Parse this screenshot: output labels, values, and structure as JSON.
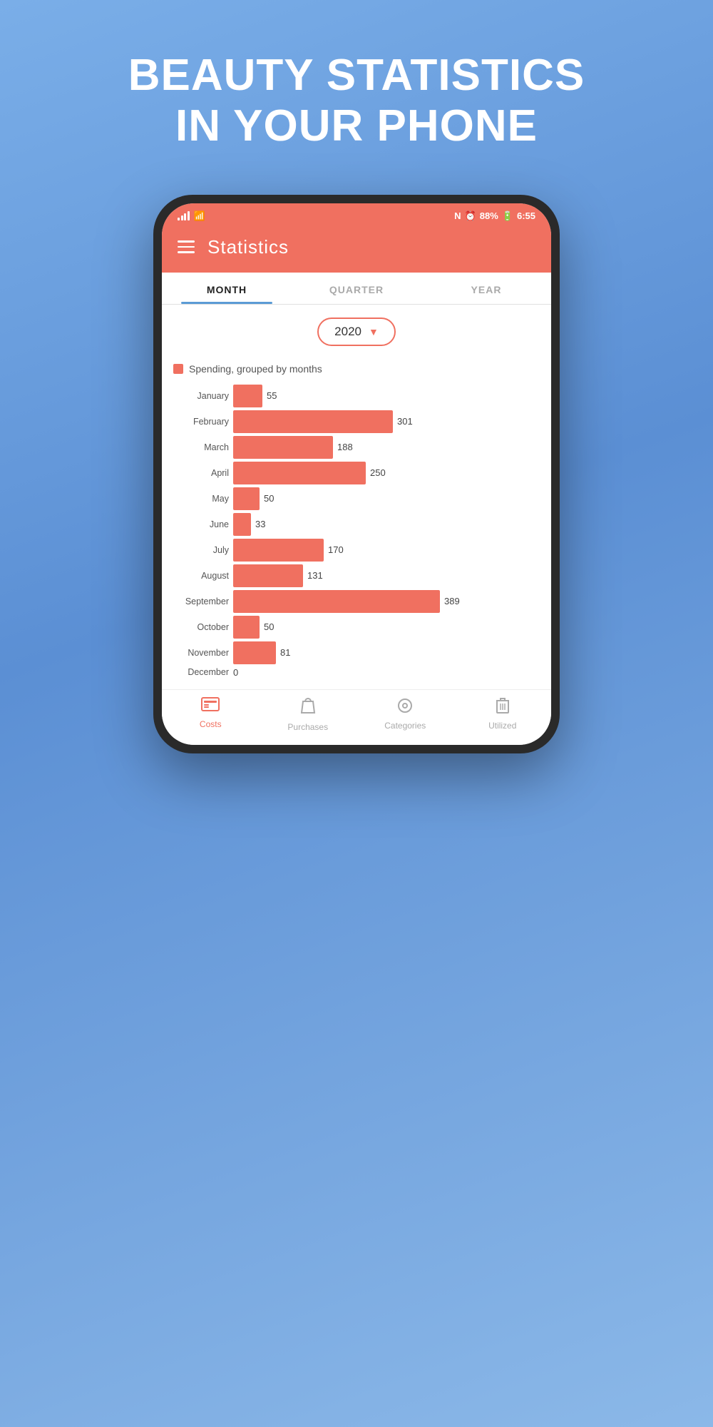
{
  "hero": {
    "line1": "BEAUTY STATISTICS",
    "line2": "IN YOUR PHONE"
  },
  "statusBar": {
    "battery": "88%",
    "time": "6:55"
  },
  "header": {
    "title": "Statistics"
  },
  "tabs": [
    {
      "label": "MONTH",
      "active": true
    },
    {
      "label": "QUARTER",
      "active": false
    },
    {
      "label": "YEAR",
      "active": false
    }
  ],
  "yearSelector": {
    "year": "2020"
  },
  "chart": {
    "legend": "Spending, grouped by months",
    "maxValue": 389,
    "bars": [
      {
        "month": "January",
        "value": 55
      },
      {
        "month": "February",
        "value": 301
      },
      {
        "month": "March",
        "value": 188
      },
      {
        "month": "April",
        "value": 250
      },
      {
        "month": "May",
        "value": 50
      },
      {
        "month": "June",
        "value": 33
      },
      {
        "month": "July",
        "value": 170
      },
      {
        "month": "August",
        "value": 131
      },
      {
        "month": "September",
        "value": 389
      },
      {
        "month": "October",
        "value": 50
      },
      {
        "month": "November",
        "value": 81
      },
      {
        "month": "December",
        "value": 0
      }
    ]
  },
  "bottomNav": [
    {
      "label": "Costs",
      "icon": "💵",
      "active": true
    },
    {
      "label": "Purchases",
      "icon": "🛍",
      "active": false
    },
    {
      "label": "Categories",
      "icon": "⊙",
      "active": false
    },
    {
      "label": "Utilized",
      "icon": "🗑",
      "active": false
    }
  ]
}
